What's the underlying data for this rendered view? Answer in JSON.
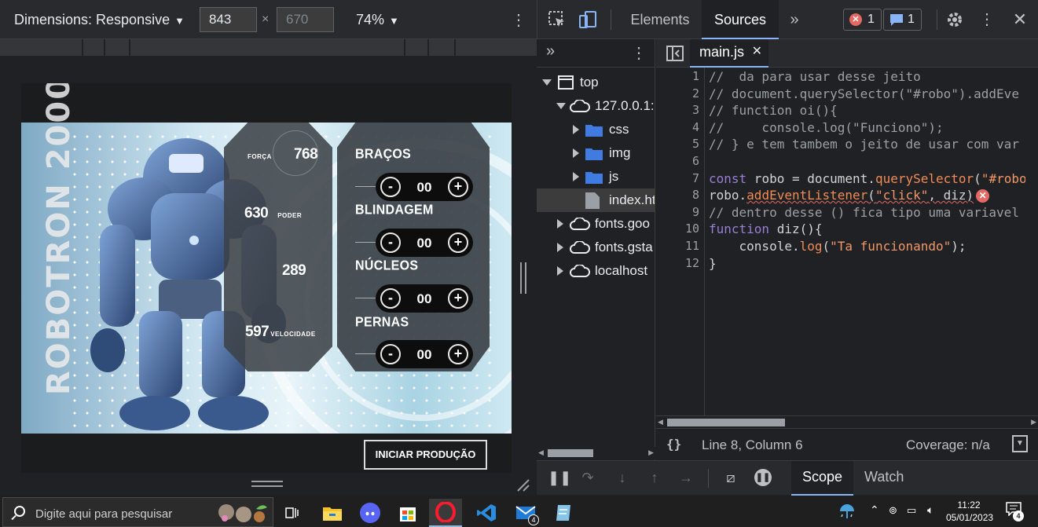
{
  "device_toolbar": {
    "dimensions_label": "Dimensions: Responsive",
    "width_value": "843",
    "height_value": "670",
    "zoom": "74%"
  },
  "page": {
    "side_title": "ROBOTRON 2000",
    "stats": [
      {
        "label": "FORÇA",
        "value": "768"
      },
      {
        "label": "PODER",
        "value": "630"
      },
      {
        "label": "",
        "value": "289"
      },
      {
        "label": "VELOCIDADE",
        "value": "597"
      }
    ],
    "parts": [
      {
        "name": "BRAÇOS",
        "value": "00",
        "minus": "-",
        "plus": "+"
      },
      {
        "name": "BLINDAGEM",
        "value": "00",
        "minus": "-",
        "plus": "+"
      },
      {
        "name": "NÚCLEOS",
        "value": "00",
        "minus": "-",
        "plus": "+"
      },
      {
        "name": "PERNAS",
        "value": "00",
        "minus": "-",
        "plus": "+"
      }
    ],
    "start_button": "INICIAR PRODUÇÃO"
  },
  "devtools": {
    "tabs": {
      "elements": "Elements",
      "sources": "Sources"
    },
    "error_count": "1",
    "message_count": "1",
    "navigator": {
      "items": [
        {
          "label": "top",
          "kind": "frame",
          "depth": 0
        },
        {
          "label": "127.0.0.1:5",
          "kind": "cloud",
          "depth": 1
        },
        {
          "label": "css",
          "kind": "folder",
          "depth": 2
        },
        {
          "label": "img",
          "kind": "folder",
          "depth": 2
        },
        {
          "label": "js",
          "kind": "folder",
          "depth": 2
        },
        {
          "label": "index.ht",
          "kind": "file",
          "depth": 2
        },
        {
          "label": "fonts.goo",
          "kind": "cloud",
          "depth": 1
        },
        {
          "label": "fonts.gsta",
          "kind": "cloud",
          "depth": 1
        },
        {
          "label": "localhost",
          "kind": "cloud",
          "depth": 1
        }
      ]
    },
    "editor": {
      "file_tab": "main.js",
      "line_numbers": [
        "1",
        "2",
        "3",
        "4",
        "5",
        "6",
        "7",
        "8",
        "9",
        "10",
        "11",
        "12"
      ],
      "lines": {
        "l1": "//  da para usar desse jeito",
        "l2": "// document.querySelector(\"#robo\").addEve",
        "l3": "// function oi(){",
        "l4": "//     console.log(\"Funciono\");",
        "l5": "// } e tem tambem o jeito de usar com var",
        "l7a": "const",
        "l7b": " robo = document.",
        "l7c": "querySelector",
        "l7d": "(",
        "l7e": "\"#robo",
        "l8a": "robo.",
        "l8b": "addEventListener",
        "l8c": "(",
        "l8d": "\"click\"",
        "l8e": ", diz)",
        "l9": "// dentro desse () fica tipo uma variavel",
        "l10a": "function",
        "l10b": " diz(){",
        "l11a": "    console.",
        "l11b": "log",
        "l11c": "(",
        "l11d": "\"Ta funcionando\"",
        "l11e": ");",
        "l12": "}"
      },
      "error_icon": "✕"
    },
    "status": {
      "braces": "{}",
      "position": "Line 8, Column 6",
      "coverage": "Coverage: n/a"
    },
    "bottom_tabs": {
      "scope": "Scope",
      "watch": "Watch"
    }
  },
  "taskbar": {
    "search_placeholder": "Digite aqui para pesquisar",
    "time": "11:22",
    "date": "05/01/2023",
    "mail_badge": "4",
    "notif_badge": "4"
  },
  "colors": {
    "devtools_bg": "#202124",
    "accent": "#8ab4f8",
    "error": "#e46962",
    "keyword": "#9a7fd5",
    "function": "#f28b54",
    "string": "#f29766"
  }
}
